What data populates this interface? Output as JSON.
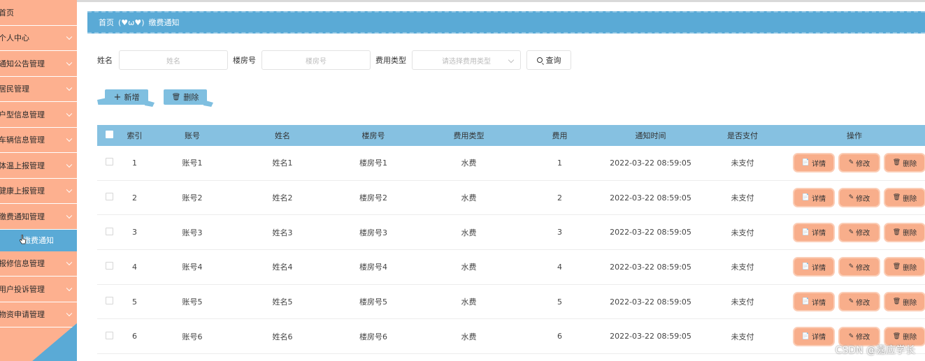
{
  "sidebar": {
    "items": [
      {
        "label": "首页"
      },
      {
        "label": "个人中心"
      },
      {
        "label": "通知公告管理"
      },
      {
        "label": "居民管理"
      },
      {
        "label": "户型信息管理"
      },
      {
        "label": "车辆信息管理"
      },
      {
        "label": "体温上报管理"
      },
      {
        "label": "健康上报管理"
      },
      {
        "label": "缴费通知管理"
      }
    ],
    "active_sub": "缴费通知",
    "items_after": [
      {
        "label": "报修信息管理"
      },
      {
        "label": "用户投诉管理"
      },
      {
        "label": "物资申请管理"
      }
    ]
  },
  "breadcrumb": {
    "home": "首页",
    "sep": "(♥ω♥)",
    "current": "缴费通知"
  },
  "search": {
    "name_label": "姓名",
    "name_placeholder": "姓名",
    "building_label": "楼房号",
    "building_placeholder": "楼房号",
    "fee_type_label": "费用类型",
    "fee_type_placeholder": "请选择费用类型",
    "query_label": "查询"
  },
  "actions": {
    "add_label": "新增",
    "delete_label": "删除"
  },
  "table": {
    "headers": [
      "索引",
      "账号",
      "姓名",
      "楼房号",
      "费用类型",
      "费用",
      "通知时间",
      "是否支付",
      "操作"
    ],
    "rows": [
      [
        "1",
        "账号1",
        "姓名1",
        "楼房号1",
        "水费",
        "1",
        "2022-03-22 08:59:05",
        "未支付"
      ],
      [
        "2",
        "账号2",
        "姓名2",
        "楼房号2",
        "水费",
        "2",
        "2022-03-22 08:59:05",
        "未支付"
      ],
      [
        "3",
        "账号3",
        "姓名3",
        "楼房号3",
        "水费",
        "3",
        "2022-03-22 08:59:05",
        "未支付"
      ],
      [
        "4",
        "账号4",
        "姓名4",
        "楼房号4",
        "水费",
        "4",
        "2022-03-22 08:59:05",
        "未支付"
      ],
      [
        "5",
        "账号5",
        "姓名5",
        "楼房号5",
        "水费",
        "5",
        "2022-03-22 08:59:05",
        "未支付"
      ],
      [
        "6",
        "账号6",
        "姓名6",
        "楼房号6",
        "水费",
        "6",
        "2022-03-22 08:59:05",
        "未支付"
      ]
    ],
    "row_ops": {
      "detail": "详情",
      "edit": "修改",
      "delete": "删除"
    }
  },
  "watermark": "CSDN @嘉应学长",
  "colors": {
    "sidebar": "#fdb08f",
    "accent_blue": "#5aaad6",
    "header_blue": "#86c1e1",
    "op_button": "#f8ae8b"
  }
}
